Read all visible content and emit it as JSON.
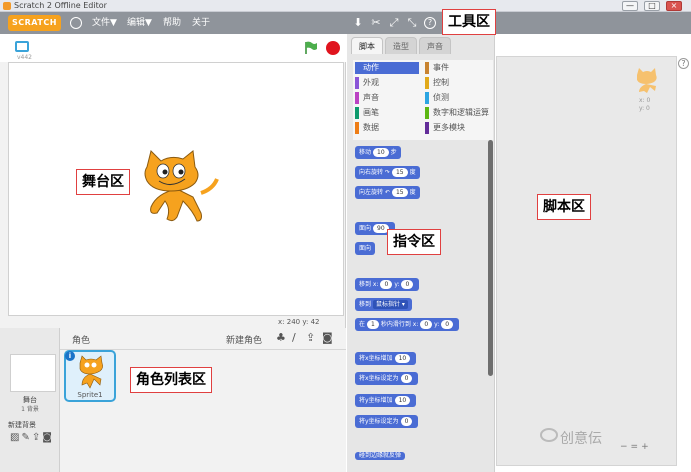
{
  "window": {
    "title": "Scratch 2 Offline Editor",
    "min_glyph": "—",
    "max_glyph": "□",
    "close_glyph": "×"
  },
  "menu": {
    "logo": "SCRATCH",
    "file": "文件▼",
    "edit": "编辑▼",
    "help": "帮助",
    "about": "关于",
    "tools_help_glyph": "?"
  },
  "stage": {
    "version": "v442",
    "coord_label_x": "x:",
    "coord_x": "240",
    "coord_label_y": "y:",
    "coord_y": "42"
  },
  "sprite_panel": {
    "title": "角色",
    "new_sprite": "新建角色",
    "stage_label": "舞台",
    "stage_count": "1 背景",
    "new_backdrop": "新建背景",
    "sprite_name": "Sprite1",
    "info_glyph": "i"
  },
  "tabs": [
    "脚本",
    "造型",
    "声音"
  ],
  "categories": [
    {
      "label": "动作",
      "color": "#4a6cd4",
      "selected": true
    },
    {
      "label": "事件",
      "color": "#c88330"
    },
    {
      "label": "外观",
      "color": "#8a55d7"
    },
    {
      "label": "控制",
      "color": "#e1a91a"
    },
    {
      "label": "声音",
      "color": "#bb42c3"
    },
    {
      "label": "侦测",
      "color": "#2ca5e2"
    },
    {
      "label": "画笔",
      "color": "#0e9a6c"
    },
    {
      "label": "数字和逻辑运算",
      "color": "#5cb712"
    },
    {
      "label": "数据",
      "color": "#ee7d16"
    },
    {
      "label": "更多模块",
      "color": "#632d99"
    }
  ],
  "blocks": {
    "move": {
      "pre": "移动",
      "val": "10",
      "post": "步"
    },
    "turn_right": {
      "pre": "向右旋转 ↷",
      "val": "15",
      "post": "度"
    },
    "turn_left": {
      "pre": "向左旋转 ↶",
      "val": "15",
      "post": "度"
    },
    "point_dir": {
      "pre": "面向",
      "val": "90"
    },
    "point_to": {
      "pre": "面向"
    },
    "goto_xy": {
      "pre": "移到 x:",
      "x": "0",
      "ymid": "y:",
      "y": "0"
    },
    "goto": {
      "pre": "移到",
      "drop": "鼠标指针 ▾"
    },
    "glide": {
      "pre": "在",
      "secs": "1",
      "mid": "秒内滑行到 x:",
      "x": "0",
      "ymid": "y:",
      "y": "0"
    },
    "change_x": {
      "pre": "将x坐标增加",
      "val": "10"
    },
    "set_x": {
      "pre": "将x坐标设定为",
      "val": "0"
    },
    "change_y": {
      "pre": "将y坐标增加",
      "val": "10"
    },
    "set_y": {
      "pre": "将y坐标设定为",
      "val": "0"
    },
    "bounce": {
      "pre": "碰到边缘就反弹"
    }
  },
  "script_area": {
    "x_label": "x: 0",
    "y_label": "y: 0",
    "help_glyph": "?"
  },
  "watermark": "创意伝",
  "annotations": {
    "tools": "工具区",
    "stage": "舞台区",
    "blocks": "指令区",
    "scripts": "脚本区",
    "sprites": "角色列表区"
  }
}
